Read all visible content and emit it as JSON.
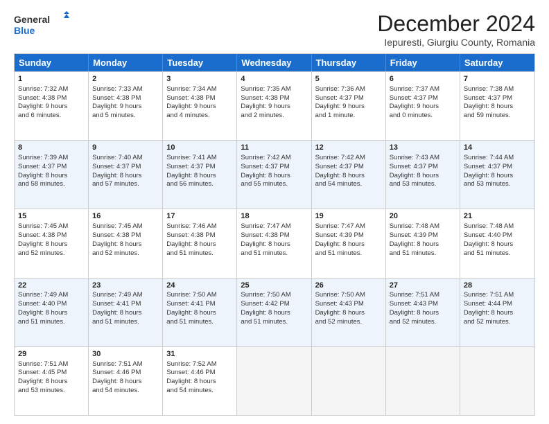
{
  "logo": {
    "general": "General",
    "blue": "Blue"
  },
  "title": "December 2024",
  "subtitle": "Iepuresti, Giurgiu County, Romania",
  "days": [
    "Sunday",
    "Monday",
    "Tuesday",
    "Wednesday",
    "Thursday",
    "Friday",
    "Saturday"
  ],
  "rows": [
    [
      {
        "day": "1",
        "lines": [
          "Sunrise: 7:32 AM",
          "Sunset: 4:38 PM",
          "Daylight: 9 hours",
          "and 6 minutes."
        ]
      },
      {
        "day": "2",
        "lines": [
          "Sunrise: 7:33 AM",
          "Sunset: 4:38 PM",
          "Daylight: 9 hours",
          "and 5 minutes."
        ]
      },
      {
        "day": "3",
        "lines": [
          "Sunrise: 7:34 AM",
          "Sunset: 4:38 PM",
          "Daylight: 9 hours",
          "and 4 minutes."
        ]
      },
      {
        "day": "4",
        "lines": [
          "Sunrise: 7:35 AM",
          "Sunset: 4:38 PM",
          "Daylight: 9 hours",
          "and 2 minutes."
        ]
      },
      {
        "day": "5",
        "lines": [
          "Sunrise: 7:36 AM",
          "Sunset: 4:37 PM",
          "Daylight: 9 hours",
          "and 1 minute."
        ]
      },
      {
        "day": "6",
        "lines": [
          "Sunrise: 7:37 AM",
          "Sunset: 4:37 PM",
          "Daylight: 9 hours",
          "and 0 minutes."
        ]
      },
      {
        "day": "7",
        "lines": [
          "Sunrise: 7:38 AM",
          "Sunset: 4:37 PM",
          "Daylight: 8 hours",
          "and 59 minutes."
        ]
      }
    ],
    [
      {
        "day": "8",
        "lines": [
          "Sunrise: 7:39 AM",
          "Sunset: 4:37 PM",
          "Daylight: 8 hours",
          "and 58 minutes."
        ]
      },
      {
        "day": "9",
        "lines": [
          "Sunrise: 7:40 AM",
          "Sunset: 4:37 PM",
          "Daylight: 8 hours",
          "and 57 minutes."
        ]
      },
      {
        "day": "10",
        "lines": [
          "Sunrise: 7:41 AM",
          "Sunset: 4:37 PM",
          "Daylight: 8 hours",
          "and 56 minutes."
        ]
      },
      {
        "day": "11",
        "lines": [
          "Sunrise: 7:42 AM",
          "Sunset: 4:37 PM",
          "Daylight: 8 hours",
          "and 55 minutes."
        ]
      },
      {
        "day": "12",
        "lines": [
          "Sunrise: 7:42 AM",
          "Sunset: 4:37 PM",
          "Daylight: 8 hours",
          "and 54 minutes."
        ]
      },
      {
        "day": "13",
        "lines": [
          "Sunrise: 7:43 AM",
          "Sunset: 4:37 PM",
          "Daylight: 8 hours",
          "and 53 minutes."
        ]
      },
      {
        "day": "14",
        "lines": [
          "Sunrise: 7:44 AM",
          "Sunset: 4:37 PM",
          "Daylight: 8 hours",
          "and 53 minutes."
        ]
      }
    ],
    [
      {
        "day": "15",
        "lines": [
          "Sunrise: 7:45 AM",
          "Sunset: 4:38 PM",
          "Daylight: 8 hours",
          "and 52 minutes."
        ]
      },
      {
        "day": "16",
        "lines": [
          "Sunrise: 7:45 AM",
          "Sunset: 4:38 PM",
          "Daylight: 8 hours",
          "and 52 minutes."
        ]
      },
      {
        "day": "17",
        "lines": [
          "Sunrise: 7:46 AM",
          "Sunset: 4:38 PM",
          "Daylight: 8 hours",
          "and 51 minutes."
        ]
      },
      {
        "day": "18",
        "lines": [
          "Sunrise: 7:47 AM",
          "Sunset: 4:38 PM",
          "Daylight: 8 hours",
          "and 51 minutes."
        ]
      },
      {
        "day": "19",
        "lines": [
          "Sunrise: 7:47 AM",
          "Sunset: 4:39 PM",
          "Daylight: 8 hours",
          "and 51 minutes."
        ]
      },
      {
        "day": "20",
        "lines": [
          "Sunrise: 7:48 AM",
          "Sunset: 4:39 PM",
          "Daylight: 8 hours",
          "and 51 minutes."
        ]
      },
      {
        "day": "21",
        "lines": [
          "Sunrise: 7:48 AM",
          "Sunset: 4:40 PM",
          "Daylight: 8 hours",
          "and 51 minutes."
        ]
      }
    ],
    [
      {
        "day": "22",
        "lines": [
          "Sunrise: 7:49 AM",
          "Sunset: 4:40 PM",
          "Daylight: 8 hours",
          "and 51 minutes."
        ]
      },
      {
        "day": "23",
        "lines": [
          "Sunrise: 7:49 AM",
          "Sunset: 4:41 PM",
          "Daylight: 8 hours",
          "and 51 minutes."
        ]
      },
      {
        "day": "24",
        "lines": [
          "Sunrise: 7:50 AM",
          "Sunset: 4:41 PM",
          "Daylight: 8 hours",
          "and 51 minutes."
        ]
      },
      {
        "day": "25",
        "lines": [
          "Sunrise: 7:50 AM",
          "Sunset: 4:42 PM",
          "Daylight: 8 hours",
          "and 51 minutes."
        ]
      },
      {
        "day": "26",
        "lines": [
          "Sunrise: 7:50 AM",
          "Sunset: 4:43 PM",
          "Daylight: 8 hours",
          "and 52 minutes."
        ]
      },
      {
        "day": "27",
        "lines": [
          "Sunrise: 7:51 AM",
          "Sunset: 4:43 PM",
          "Daylight: 8 hours",
          "and 52 minutes."
        ]
      },
      {
        "day": "28",
        "lines": [
          "Sunrise: 7:51 AM",
          "Sunset: 4:44 PM",
          "Daylight: 8 hours",
          "and 52 minutes."
        ]
      }
    ],
    [
      {
        "day": "29",
        "lines": [
          "Sunrise: 7:51 AM",
          "Sunset: 4:45 PM",
          "Daylight: 8 hours",
          "and 53 minutes."
        ]
      },
      {
        "day": "30",
        "lines": [
          "Sunrise: 7:51 AM",
          "Sunset: 4:46 PM",
          "Daylight: 8 hours",
          "and 54 minutes."
        ]
      },
      {
        "day": "31",
        "lines": [
          "Sunrise: 7:52 AM",
          "Sunset: 4:46 PM",
          "Daylight: 8 hours",
          "and 54 minutes."
        ]
      },
      null,
      null,
      null,
      null
    ]
  ]
}
